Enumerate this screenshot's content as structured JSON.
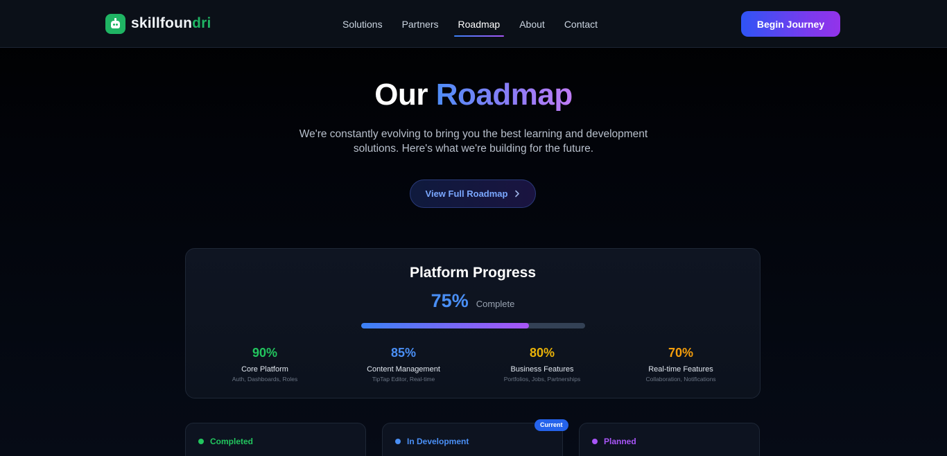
{
  "nav": {
    "logo": {
      "prefix": "skillfoun",
      "suffix": "dri"
    },
    "links": [
      {
        "label": "Solutions",
        "active": false
      },
      {
        "label": "Partners",
        "active": false
      },
      {
        "label": "Roadmap",
        "active": true
      },
      {
        "label": "About",
        "active": false
      },
      {
        "label": "Contact",
        "active": false
      }
    ],
    "cta_label": "Begin Journey"
  },
  "hero": {
    "title_plain": "Our",
    "title_accent": "Roadmap",
    "subtitle_line1": "We're constantly evolving to bring you the best learning and development",
    "subtitle_line2": "solutions. Here's what we're building for the future.",
    "button_label": "View Full Roadmap",
    "button_icon": "chevron-right-icon"
  },
  "progress": {
    "title": "Platform Progress",
    "overall_percent": "75%",
    "overall_fraction": 0.75,
    "overall_label": "Complete",
    "items": [
      {
        "percent": "90%",
        "name": "Core Platform",
        "desc": "Auth, Dashboards, Roles",
        "color": "#22c55e"
      },
      {
        "percent": "85%",
        "name": "Content Management",
        "desc": "TipTap Editor, Real-time",
        "color": "#4a8ff5"
      },
      {
        "percent": "80%",
        "name": "Business Features",
        "desc": "Portfolios, Jobs, Partnerships",
        "color": "#eab308"
      },
      {
        "percent": "70%",
        "name": "Real-time Features",
        "desc": "Collaboration, Notifications",
        "color": "#f59e0b"
      }
    ]
  },
  "status_columns": [
    {
      "label": "Completed",
      "color": "#22c55e"
    },
    {
      "label": "In Development",
      "color": "#4a8ff5",
      "badge": "Current"
    },
    {
      "label": "Planned",
      "color": "#a855f7"
    }
  ],
  "colors": {
    "brand_green": "#1fb463",
    "accent_blue": "#3b82f6",
    "accent_purple": "#a855f7"
  }
}
